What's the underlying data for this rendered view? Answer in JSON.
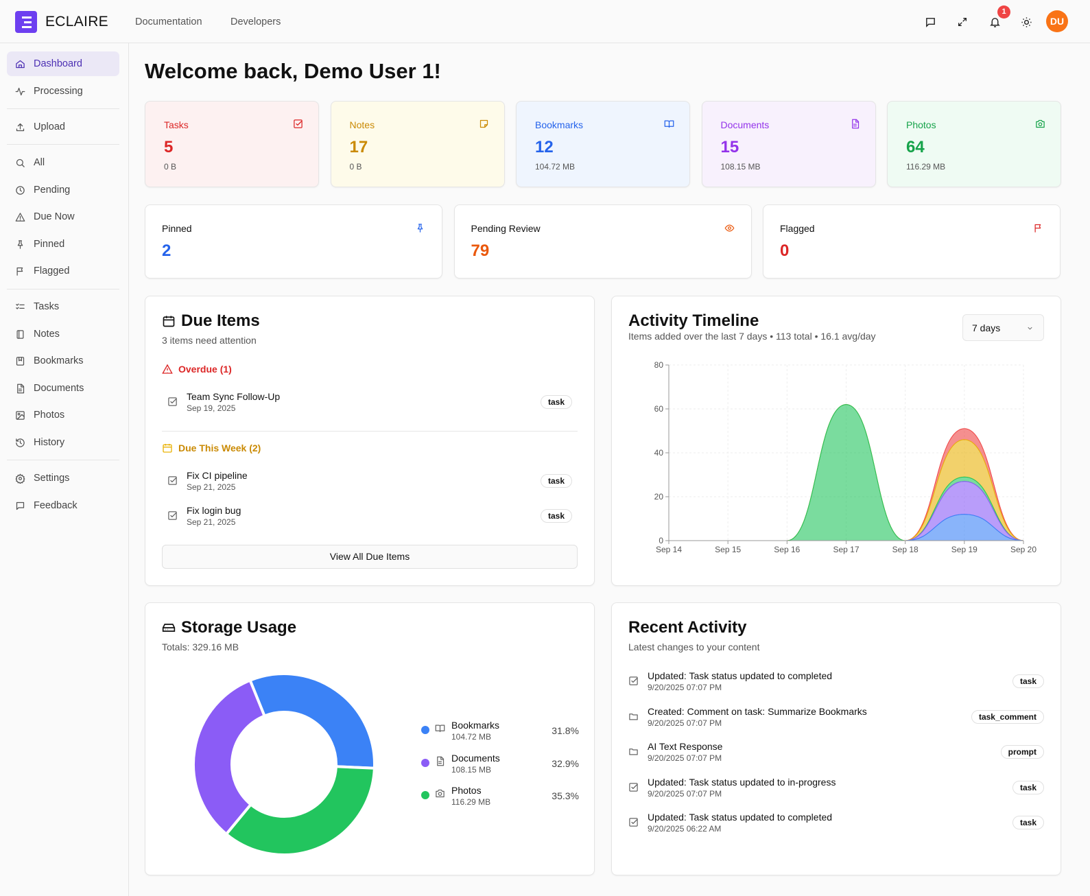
{
  "app": {
    "brand": "ECLAIRE",
    "nav": [
      "Documentation",
      "Developers"
    ],
    "notification_count": "1",
    "avatar_initials": "DU"
  },
  "sidebar": {
    "items": [
      {
        "label": "Dashboard",
        "icon": "home-icon",
        "active": true
      },
      {
        "label": "Processing",
        "icon": "activity-icon"
      },
      {
        "label": "Upload",
        "icon": "upload-icon"
      },
      {
        "label": "All",
        "icon": "search-icon"
      },
      {
        "label": "Pending",
        "icon": "clock-icon"
      },
      {
        "label": "Due Now",
        "icon": "alert-triangle-icon"
      },
      {
        "label": "Pinned",
        "icon": "pin-icon"
      },
      {
        "label": "Flagged",
        "icon": "flag-icon"
      },
      {
        "label": "Tasks",
        "icon": "list-checks-icon"
      },
      {
        "label": "Notes",
        "icon": "notebook-icon"
      },
      {
        "label": "Bookmarks",
        "icon": "bookmark-icon"
      },
      {
        "label": "Documents",
        "icon": "file-icon"
      },
      {
        "label": "Photos",
        "icon": "image-icon"
      },
      {
        "label": "History",
        "icon": "history-icon"
      },
      {
        "label": "Settings",
        "icon": "gear-icon"
      },
      {
        "label": "Feedback",
        "icon": "message-icon"
      }
    ]
  },
  "main": {
    "title": "Welcome back, Demo User 1!",
    "stats": [
      {
        "label": "Tasks",
        "value": "5",
        "size": "0 B",
        "color": "#dc2626",
        "bg": "#fdf1f1",
        "icon": "check-square-icon"
      },
      {
        "label": "Notes",
        "value": "17",
        "size": "0 B",
        "color": "#ca8a04",
        "bg": "#fefbea",
        "icon": "sticky-note-icon"
      },
      {
        "label": "Bookmarks",
        "value": "12",
        "size": "104.72 MB",
        "color": "#2563eb",
        "bg": "#eff5fe",
        "icon": "book-open-icon"
      },
      {
        "label": "Documents",
        "value": "15",
        "size": "108.15 MB",
        "color": "#9333ea",
        "bg": "#f8f1fd",
        "icon": "file-text-icon"
      },
      {
        "label": "Photos",
        "value": "64",
        "size": "116.29 MB",
        "color": "#16a34a",
        "bg": "#effbf3",
        "icon": "camera-icon"
      }
    ],
    "status_cards": [
      {
        "label": "Pinned",
        "value": "2",
        "color": "#2563eb",
        "icon": "pin-icon"
      },
      {
        "label": "Pending Review",
        "value": "79",
        "color": "#ea580c",
        "icon": "eye-icon"
      },
      {
        "label": "Flagged",
        "value": "0",
        "color": "#dc2626",
        "icon": "flag-icon"
      }
    ]
  },
  "due": {
    "title": "Due Items",
    "subtitle": "3 items need attention",
    "overdue_label": "Overdue (1)",
    "week_label": "Due This Week (2)",
    "overdue": [
      {
        "title": "Team Sync Follow-Up",
        "date": "Sep 19, 2025",
        "tag": "task"
      }
    ],
    "week": [
      {
        "title": "Fix CI pipeline",
        "date": "Sep 21, 2025",
        "tag": "task"
      },
      {
        "title": "Fix login bug",
        "date": "Sep 21, 2025",
        "tag": "task"
      }
    ],
    "view_all": "View All Due Items"
  },
  "timeline": {
    "title": "Activity Timeline",
    "subtitle": "Items added over the last 7 days • 113 total • 16.1 avg/day",
    "range": "7 days"
  },
  "chart_data": {
    "type": "area",
    "stacked": true,
    "x": [
      "Sep 14",
      "Sep 15",
      "Sep 16",
      "Sep 17",
      "Sep 18",
      "Sep 19",
      "Sep 20"
    ],
    "ylim": [
      0,
      80
    ],
    "yticks": [
      0,
      20,
      40,
      60,
      80
    ],
    "grid": true,
    "series": [
      {
        "key": "bookmarks",
        "color": "#3b82f6",
        "values": [
          0,
          0,
          0,
          0,
          0,
          12,
          0
        ]
      },
      {
        "key": "documents",
        "color": "#8b5cf6",
        "values": [
          0,
          0,
          0,
          0,
          0,
          15,
          0
        ]
      },
      {
        "key": "photos",
        "color": "#22c55e",
        "values": [
          0,
          0,
          0,
          62,
          0,
          2,
          0
        ]
      },
      {
        "key": "notes",
        "color": "#eab308",
        "values": [
          0,
          0,
          0,
          0,
          0,
          17,
          0
        ]
      },
      {
        "key": "tasks",
        "color": "#ef4444",
        "values": [
          0,
          0,
          0,
          0,
          0,
          5,
          0
        ]
      }
    ]
  },
  "storage": {
    "title": "Storage Usage",
    "totals": "Totals: 329.16 MB",
    "slices": [
      {
        "name": "Bookmarks",
        "size": "104.72 MB",
        "percent": 31.8,
        "percent_label": "31.8%",
        "color": "#3b82f6",
        "icon": "book-open-icon"
      },
      {
        "name": "Documents",
        "size": "108.15 MB",
        "percent": 32.9,
        "percent_label": "32.9%",
        "color": "#8b5cf6",
        "icon": "file-text-icon"
      },
      {
        "name": "Photos",
        "size": "116.29 MB",
        "percent": 35.3,
        "percent_label": "35.3%",
        "color": "#22c55e",
        "icon": "camera-icon"
      }
    ]
  },
  "recent": {
    "title": "Recent Activity",
    "subtitle": "Latest changes to your content",
    "items": [
      {
        "title": "Updated: Task status updated to completed",
        "time": "9/20/2025 07:07 PM",
        "tag": "task",
        "icon": "check-square-icon"
      },
      {
        "title": "Created: Comment on task: Summarize Bookmarks",
        "time": "9/20/2025 07:07 PM",
        "tag": "task_comment",
        "icon": "folder-icon"
      },
      {
        "title": "AI Text Response",
        "time": "9/20/2025 07:07 PM",
        "tag": "prompt",
        "icon": "folder-icon"
      },
      {
        "title": "Updated: Task status updated to in-progress",
        "time": "9/20/2025 07:07 PM",
        "tag": "task",
        "icon": "check-square-icon"
      },
      {
        "title": "Updated: Task status updated to completed",
        "time": "9/20/2025 06:22 AM",
        "tag": "task",
        "icon": "check-square-icon"
      }
    ]
  }
}
